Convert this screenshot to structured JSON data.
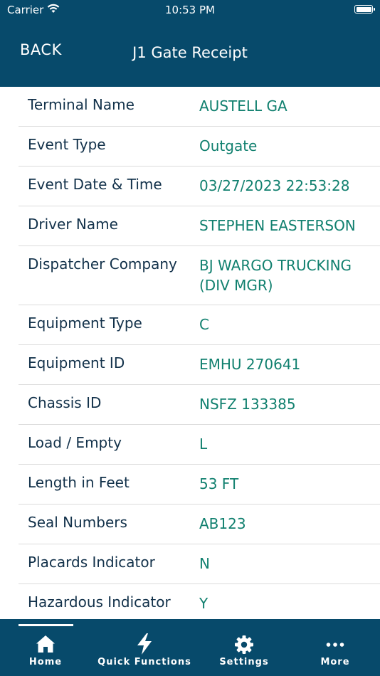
{
  "status_bar": {
    "carrier": "Carrier",
    "time": "10:53 PM"
  },
  "nav": {
    "back_label": "BACK",
    "title": "J1 Gate Receipt"
  },
  "receipt": {
    "rows": [
      {
        "label": "Terminal Name",
        "value": "AUSTELL GA"
      },
      {
        "label": "Event Type",
        "value": "Outgate"
      },
      {
        "label": "Event Date & Time",
        "value": "03/27/2023 22:53:28"
      },
      {
        "label": "Driver Name",
        "value": "STEPHEN EASTERSON"
      },
      {
        "label": "Dispatcher Company",
        "value": "BJ WARGO TRUCKING (DIV MGR)"
      },
      {
        "label": "Equipment Type",
        "value": "C"
      },
      {
        "label": "Equipment ID",
        "value": "EMHU 270641"
      },
      {
        "label": "Chassis ID",
        "value": "NSFZ 133385"
      },
      {
        "label": "Load / Empty",
        "value": "L"
      },
      {
        "label": "Length in Feet",
        "value": "53 FT"
      },
      {
        "label": "Seal Numbers",
        "value": "AB123"
      },
      {
        "label": "Placards Indicator",
        "value": "N"
      },
      {
        "label": "Hazardous Indicator",
        "value": "Y"
      }
    ]
  },
  "tabs": {
    "home": {
      "label": "Home",
      "icon": "home-icon"
    },
    "quick": {
      "label": "Quick Functions",
      "icon": "lightning-icon"
    },
    "settings": {
      "label": "Settings",
      "icon": "gear-icon"
    },
    "more": {
      "label": "More",
      "icon": "more-dots-icon"
    },
    "active": "home"
  },
  "colors": {
    "header": "#074a6b",
    "value_text": "#11806f",
    "label_text": "#12314a"
  }
}
